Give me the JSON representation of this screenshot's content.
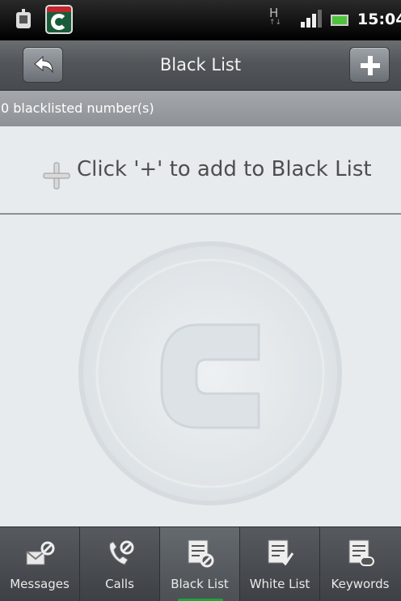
{
  "status_bar": {
    "network_type": "H",
    "network_arrows": "↑↓",
    "time": "15:04",
    "icons": [
      "android-debug-icon",
      "comodo-app-icon",
      "signal-icon",
      "battery-icon"
    ]
  },
  "title_bar": {
    "title": "Black List",
    "back_icon": "back-arrow-icon",
    "add_icon": "plus-icon"
  },
  "count": {
    "text": "0 blacklisted number(s)"
  },
  "empty_state": {
    "hint": "Click '+' to add to Black List",
    "hint_icon": "plus-icon",
    "watermark": "comodo-logo-watermark"
  },
  "tabs": [
    {
      "label": "Messages",
      "icon": "message-block-icon",
      "active": false
    },
    {
      "label": "Calls",
      "icon": "phone-block-icon",
      "active": false
    },
    {
      "label": "Black List",
      "icon": "list-block-icon",
      "active": true
    },
    {
      "label": "White List",
      "icon": "list-check-icon",
      "active": false
    },
    {
      "label": "Keywords",
      "icon": "keyword-list-icon",
      "active": false
    }
  ],
  "colors": {
    "accent_indicator": "#1ba33c",
    "title_bar": "#55595d",
    "content_bg": "#e7ebee"
  }
}
